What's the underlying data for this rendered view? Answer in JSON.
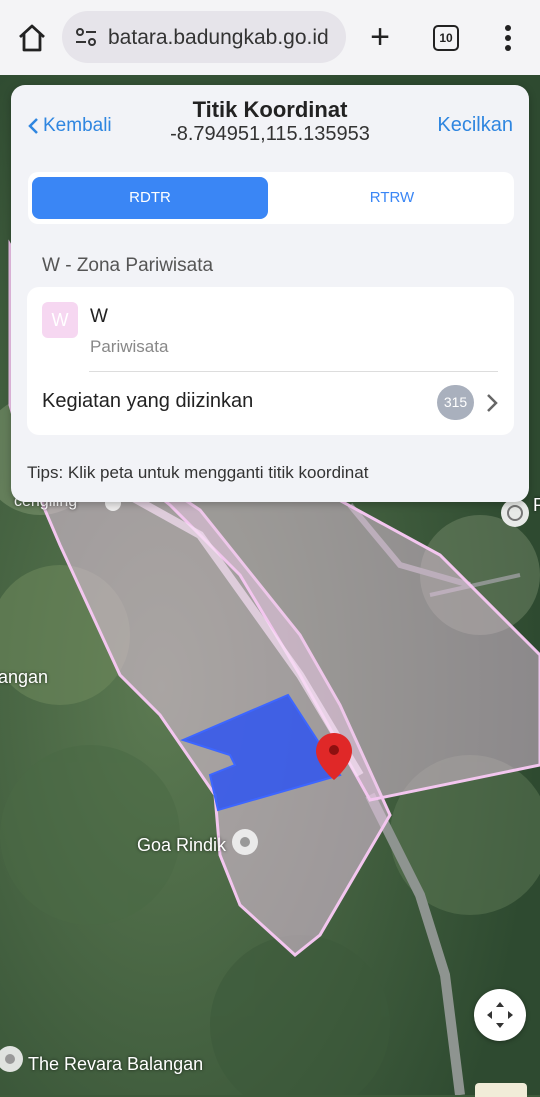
{
  "browser": {
    "url": "batara.badungkab.go.id",
    "tab_count": "10",
    "icons": [
      "home-icon",
      "tune-icon",
      "plus-icon",
      "tab-switcher-icon",
      "more-vert-icon"
    ]
  },
  "panel": {
    "back_label": "Kembali",
    "title": "Titik Koordinat",
    "coordinates": "-8.794951,115.135953",
    "shrink_label": "Kecilkan",
    "tabs": [
      {
        "label": "RDTR",
        "active": true
      },
      {
        "label": "RTRW",
        "active": false
      }
    ],
    "zone_heading": "W - Zona Pariwisata",
    "zone": {
      "icon_letter": "W",
      "code": "W",
      "name": "Pariwisata",
      "color": "#f6d7f1"
    },
    "kegiatan_label": "Kegiatan yang diizinkan",
    "kegiatan_count": "315",
    "tips": "Tips: Klik peta untuk mengganti titik koordinat"
  },
  "map": {
    "labels": {
      "goa": "Goa Rindik",
      "revara": "The Revara Balangan",
      "angan": "angan",
      "cengiling": "cengiling",
      "edge_p": "P"
    },
    "colors": {
      "accent": "#3a86f5",
      "zone_fill": "#e9c8e6",
      "parcel": "#2f55f0",
      "pin": "#e02828"
    }
  }
}
